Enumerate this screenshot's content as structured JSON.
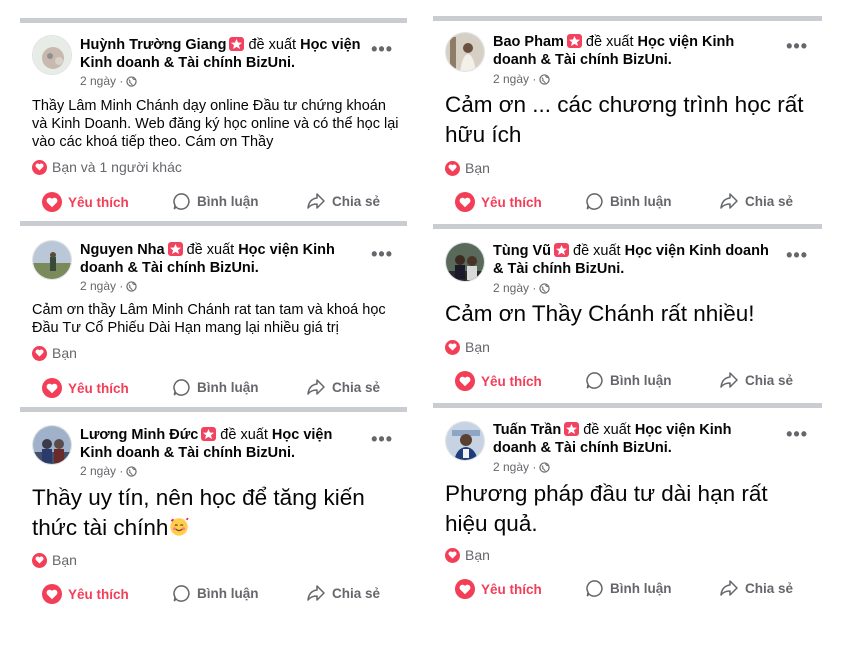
{
  "ui": {
    "verb": "đề xuất",
    "page_name": "Học viện Kinh doanh & Tài chính BizUni.",
    "like_label": "Yêu thích",
    "comment_label": "Bình luận",
    "share_label": "Chia sẻ",
    "more_label": "•••",
    "timestamp": "2 ngày ·"
  },
  "colors": {
    "accent": "#f33e58",
    "muted": "#65676b",
    "divider": "#c9ccd1"
  },
  "posts": [
    {
      "author": "Huỳnh Trường Giang",
      "text": "Thầy Lâm Minh Chánh dạy online Đầu tư chứng khoán và Kinh Doanh. Web đăng ký học online và có thể học lại vào các khoá tiếp theo. Cám ơn Thầy",
      "reactions": "Bạn và 1 người khác"
    },
    {
      "author": "Nguyen Nha",
      "text": "Cảm ơn thầy Lâm Minh Chánh rat tan tam và khoá học Đầu Tư Cổ Phiếu Dài Hạn mang lại nhiều giá trị",
      "reactions": "Bạn"
    },
    {
      "author": "Lương Minh Đức",
      "text": "Thầy uy tín, nên học để tăng kiến thức tài chính",
      "emoji": "smiling-face-with-hearts",
      "reactions": "Bạn"
    },
    {
      "author": "Bao Pham",
      "text": "Cảm ơn ... các chương trình học rất hữu ích",
      "reactions": "Bạn"
    },
    {
      "author": "Tùng Vũ",
      "text": "Cảm ơn Thầy Chánh rất nhiều!",
      "reactions": "Bạn"
    },
    {
      "author": "Tuấn Trần",
      "text": "Phương pháp đầu tư dài hạn rất hiệu quả.",
      "reactions": "Bạn"
    }
  ]
}
